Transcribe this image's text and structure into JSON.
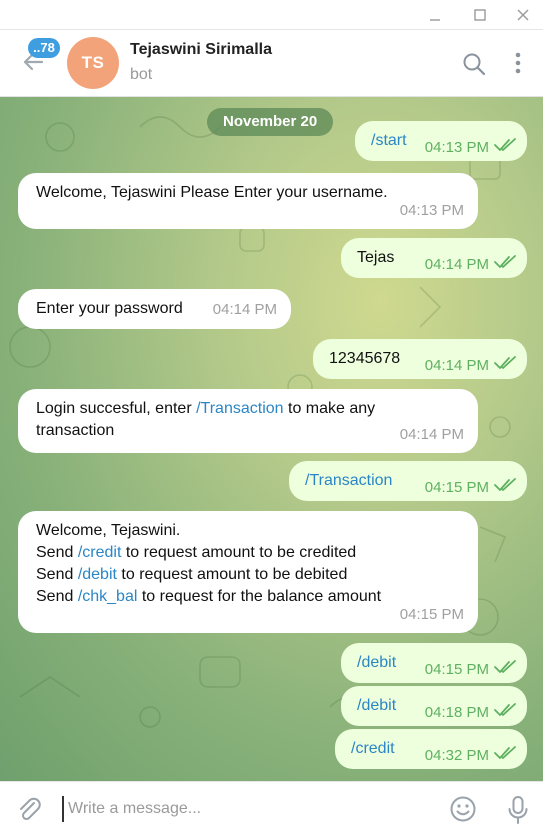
{
  "window": {
    "minimize_icon": "minimize-icon",
    "maximize_icon": "maximize-icon",
    "close_icon": "close-icon"
  },
  "header": {
    "back_icon": "arrow-left-icon",
    "unread_badge": "..78",
    "avatar_initials": "TS",
    "avatar_color": "#f3a37a",
    "name": "Tejaswini Sirimalla",
    "status": "bot",
    "search_icon": "search-icon",
    "more_icon": "more-vertical-icon"
  },
  "chat": {
    "date": "November 20",
    "messages": [
      {
        "dir": "out",
        "text": "/start",
        "time": "04:13 PM"
      },
      {
        "dir": "in",
        "text": "Welcome, Tejaswini Please Enter your username.",
        "time": "04:13 PM"
      },
      {
        "dir": "out",
        "text": "Tejas",
        "time": "04:14 PM"
      },
      {
        "dir": "in",
        "text": "Enter your password",
        "time": "04:14 PM"
      },
      {
        "dir": "out",
        "text": "12345678",
        "time": "04:14 PM"
      },
      {
        "dir": "in",
        "line1_before": "Login succesful, enter ",
        "line1_cmd": "/Transaction",
        "line1_after": " to make any",
        "line2": "transaction",
        "time": "04:14 PM"
      },
      {
        "dir": "out",
        "text": "/Transaction",
        "time": "04:15 PM"
      },
      {
        "dir": "in",
        "line1": "Welcome, Tejaswini.",
        "l2_pre": "Send ",
        "l2_cmd": "/credit",
        "l2_post": " to request amount to be credited",
        "l3_pre": "Send ",
        "l3_cmd": "/debit",
        "l3_post": " to request amount to be debited",
        "l4_pre": "Send ",
        "l4_cmd": "/chk_bal",
        "l4_post": " to request for the balance amount",
        "time": "04:15 PM"
      },
      {
        "dir": "out",
        "text": "/debit",
        "time": "04:15 PM"
      },
      {
        "dir": "out",
        "text": "/debit",
        "time": "04:18 PM"
      },
      {
        "dir": "out",
        "text": "/credit",
        "time": "04:32 PM"
      }
    ]
  },
  "composer": {
    "placeholder": "Write a message...",
    "attach_icon": "paperclip-icon",
    "emoji_icon": "emoji-icon",
    "mic_icon": "microphone-icon"
  },
  "colors": {
    "accent": "#3f9ee0",
    "command": "#2b86c5",
    "outgoing_bg": "#eeffde",
    "outgoing_time": "#5fb061"
  }
}
